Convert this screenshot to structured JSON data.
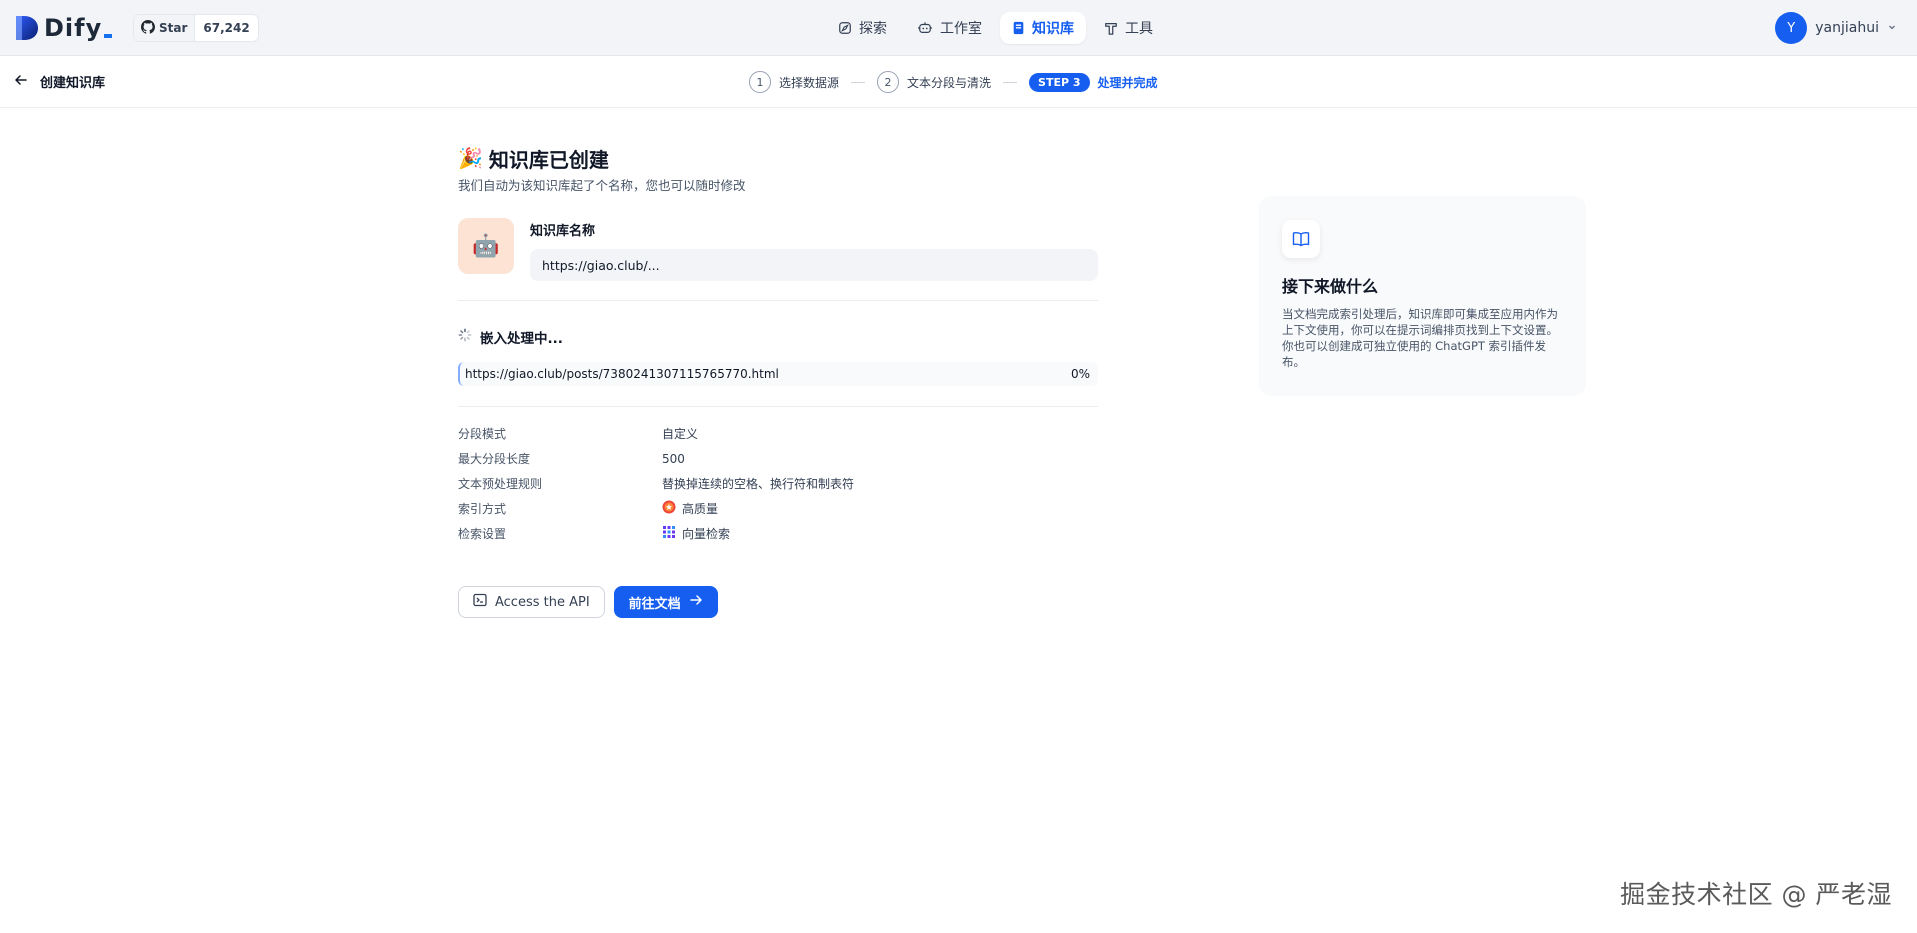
{
  "app": {
    "logo_text": "Dify",
    "github_star_label": "Star",
    "github_star_count": "67,242"
  },
  "nav": {
    "items": [
      {
        "label": "探索",
        "icon": "compass-icon"
      },
      {
        "label": "工作室",
        "icon": "robot-icon"
      },
      {
        "label": "知识库",
        "icon": "book-icon",
        "active": true
      },
      {
        "label": "工具",
        "icon": "hammer-icon"
      }
    ]
  },
  "user": {
    "avatar_initial": "Y",
    "name": "yanjiahui"
  },
  "subheader": {
    "back_label": "创建知识库",
    "steps": [
      {
        "num": "1",
        "label": "选择数据源"
      },
      {
        "num": "2",
        "label": "文本分段与清洗"
      },
      {
        "num": "STEP 3",
        "label": "处理并完成",
        "active": true
      }
    ]
  },
  "main": {
    "title_emoji": "🎉",
    "title": "知识库已创建",
    "subtitle": "我们自动为该知识库起了个名称，您也可以随时修改",
    "kb_icon_emoji": "🤖",
    "name_label": "知识库名称",
    "name_value": "https://giao.club/...",
    "processing_label": "嵌入处理中...",
    "progress": {
      "file": "https://giao.club/posts/7380241307115765770.html",
      "percent_text": "0%",
      "percent": 0
    },
    "rules": [
      {
        "key": "分段模式",
        "value": "自定义"
      },
      {
        "key": "最大分段长度",
        "value": "500"
      },
      {
        "key": "文本预处理规则",
        "value": "替换掉连续的空格、换行符和制表符"
      },
      {
        "key": "索引方式",
        "value": "高质量",
        "icon": "high-quality-icon"
      },
      {
        "key": "检索设置",
        "value": "向量检索",
        "icon": "vector-search-icon"
      }
    ],
    "btn_api": "Access the API",
    "btn_docs": "前往文档"
  },
  "side": {
    "title": "接下来做什么",
    "body": "当文档完成索引处理后，知识库即可集成至应用内作为上下文使用，你可以在提示词编排页找到上下文设置。你也可以创建成可独立使用的 ChatGPT 索引插件发布。"
  },
  "watermark": "掘金技术社区 @ 严老湿",
  "colors": {
    "accent": "#155eef",
    "nav_bg": "#f2f4f7",
    "kb_icon_bg": "#fde3d3"
  }
}
